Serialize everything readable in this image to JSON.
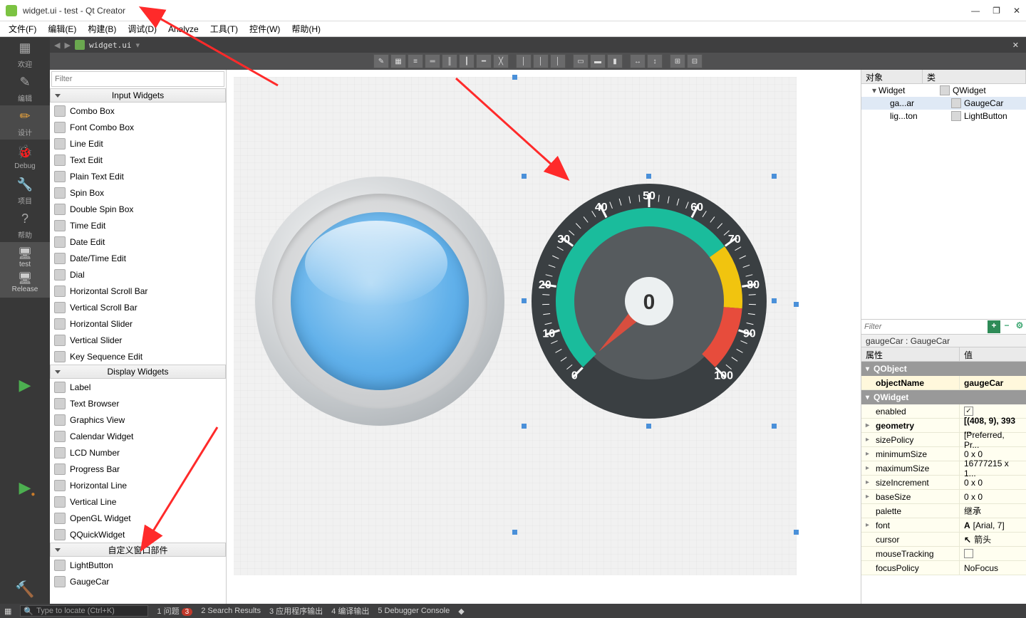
{
  "titlebar": {
    "title": "widget.ui - test - Qt Creator"
  },
  "menubar": [
    "文件(F)",
    "编辑(E)",
    "构建(B)",
    "调试(D)",
    "Analyze",
    "工具(T)",
    "控件(W)",
    "帮助(H)"
  ],
  "sidebar": {
    "items": [
      {
        "label": "欢迎",
        "icon": "grid"
      },
      {
        "label": "编辑",
        "icon": "edit"
      },
      {
        "label": "设计",
        "icon": "pencil",
        "active": true
      },
      {
        "label": "Debug",
        "icon": "bug"
      },
      {
        "label": "项目",
        "icon": "wrench"
      },
      {
        "label": "帮助",
        "icon": "help"
      }
    ],
    "build_target": "test",
    "build_config": "Release"
  },
  "doc": {
    "filename": "widget.ui"
  },
  "widget_box": {
    "filter_placeholder": "Filter",
    "categories": [
      {
        "name": "Input Widgets",
        "items": [
          "Combo Box",
          "Font Combo Box",
          "Line Edit",
          "Text Edit",
          "Plain Text Edit",
          "Spin Box",
          "Double Spin Box",
          "Time Edit",
          "Date Edit",
          "Date/Time Edit",
          "Dial",
          "Horizontal Scroll Bar",
          "Vertical Scroll Bar",
          "Horizontal Slider",
          "Vertical Slider",
          "Key Sequence Edit"
        ]
      },
      {
        "name": "Display Widgets",
        "items": [
          "Label",
          "Text Browser",
          "Graphics View",
          "Calendar Widget",
          "LCD Number",
          "Progress Bar",
          "Horizontal Line",
          "Vertical Line",
          "OpenGL Widget",
          "QQuickWidget"
        ]
      },
      {
        "name": "自定义窗口部件",
        "items": [
          "LightButton",
          "GaugeCar"
        ]
      }
    ]
  },
  "object_inspector": {
    "columns": [
      "对象",
      "类"
    ],
    "tree": [
      {
        "name": "Widget",
        "cls": "QWidget",
        "depth": 0,
        "expandable": true
      },
      {
        "name": "ga...ar",
        "cls": "GaugeCar",
        "depth": 1,
        "sel": true
      },
      {
        "name": "lig...ton",
        "cls": "LightButton",
        "depth": 1
      }
    ]
  },
  "property_editor": {
    "filter_placeholder": "Filter",
    "header": "gaugeCar : GaugeCar",
    "columns": [
      "属性",
      "值"
    ],
    "groups": [
      {
        "name": "QObject",
        "rows": [
          {
            "k": "objectName",
            "v": "gaugeCar",
            "bold": true
          }
        ]
      },
      {
        "name": "QWidget",
        "rows": [
          {
            "k": "enabled",
            "v": "",
            "check": true,
            "checked": true
          },
          {
            "k": "geometry",
            "v": "[(408, 9), 393 ...",
            "exp": true,
            "bold": true
          },
          {
            "k": "sizePolicy",
            "v": "[Preferred, Pr...",
            "exp": true
          },
          {
            "k": "minimumSize",
            "v": "0 x 0",
            "exp": true
          },
          {
            "k": "maximumSize",
            "v": "16777215 x 1...",
            "exp": true
          },
          {
            "k": "sizeIncrement",
            "v": "0 x 0",
            "exp": true
          },
          {
            "k": "baseSize",
            "v": "0 x 0",
            "exp": true
          },
          {
            "k": "palette",
            "v": "继承"
          },
          {
            "k": "font",
            "v": "[Arial, 7]",
            "exp": true,
            "ficon": "A"
          },
          {
            "k": "cursor",
            "v": "箭头",
            "ficon": "↖"
          },
          {
            "k": "mouseTracking",
            "v": "",
            "check": true,
            "checked": false
          },
          {
            "k": "focusPolicy",
            "v": "NoFocus"
          }
        ]
      }
    ]
  },
  "gauge_data": {
    "value": 0,
    "min": 0,
    "max": 100,
    "step": 10,
    "ticks": [
      0,
      10,
      20,
      30,
      40,
      50,
      60,
      70,
      80,
      90,
      100
    ]
  },
  "statusbar": {
    "locator_placeholder": "Type to locate (Ctrl+K)",
    "panes": [
      {
        "idx": "1",
        "label": "问题",
        "badge": "3"
      },
      {
        "idx": "2",
        "label": "Search Results"
      },
      {
        "idx": "3",
        "label": "应用程序输出"
      },
      {
        "idx": "4",
        "label": "编译输出"
      },
      {
        "idx": "5",
        "label": "Debugger Console"
      }
    ]
  }
}
